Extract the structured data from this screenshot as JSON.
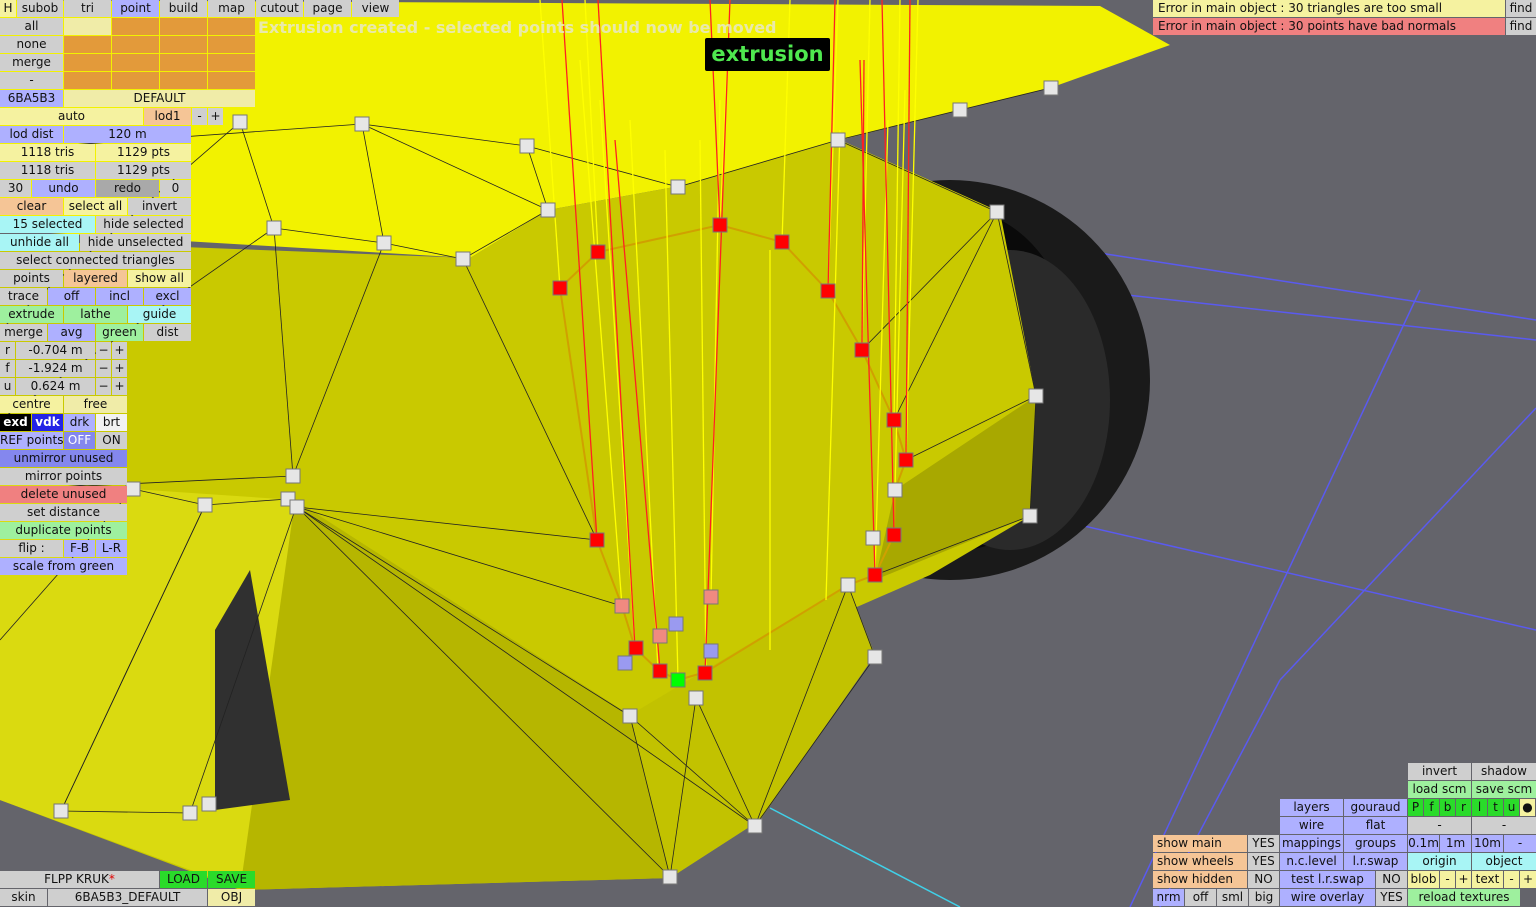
{
  "top_tabs": {
    "h": "H",
    "subob": "subob",
    "tri": "tri",
    "point": "point",
    "build": "build",
    "map": "map",
    "cutout": "cutout",
    "page": "page",
    "view": "view"
  },
  "status_message": "Extrusion created - selected points should now be moved",
  "mode_badge": "extrusion",
  "errors": [
    {
      "text": "Error in main object : 30 triangles are too small",
      "action": "find"
    },
    {
      "text": "Error in main object : 30 points have bad normals",
      "action": "find"
    }
  ],
  "left": {
    "all": "all",
    "none": "none",
    "merge": "merge",
    "dash": "-",
    "object_id": "6BA5B3",
    "skin_name": "DEFAULT",
    "auto": "auto",
    "lod": "lod1",
    "minus": "-",
    "plus": "+",
    "lod_dist_label": "lod dist",
    "lod_dist_value": "120 m",
    "tris1": "1118 tris",
    "pts1": "1129 pts",
    "tris2": "1118 tris",
    "pts2": "1129 pts",
    "undo_count": "30",
    "undo": "undo",
    "redo": "redo",
    "redo_count": "0",
    "clear": "clear",
    "select_all": "select all",
    "invert": "invert",
    "selected": "15 selected",
    "hide_selected": "hide selected",
    "unhide_all": "unhide all",
    "hide_unselected": "hide unselected",
    "select_connected": "select connected triangles",
    "points": "points",
    "layered": "layered",
    "show_all": "show all",
    "trace": "trace",
    "off": "off",
    "incl": "incl",
    "excl": "excl",
    "extrude": "extrude",
    "lathe": "lathe",
    "guide": "guide",
    "merge2": "merge",
    "avg": "avg",
    "green": "green",
    "dist": "dist",
    "r_label": "r",
    "r_value": "-0.704 m",
    "f_label": "f",
    "f_value": "-1.924 m",
    "u_label": "u",
    "u_value": "0.624 m",
    "centre": "centre",
    "free": "free",
    "exd": "exd",
    "vdk": "vdk",
    "drk": "drk",
    "brt": "brt",
    "ref_points": "REF points",
    "ref_off": "OFF",
    "ref_on": "ON",
    "unmirror": "unmirror unused",
    "mirror": "mirror points",
    "delete_unused": "delete unused",
    "set_distance": "set distance",
    "duplicate": "duplicate points",
    "flip": "flip :",
    "fb": "F-B",
    "lr": "L-R",
    "scale_green": "scale from green"
  },
  "bottom_left": {
    "car_name": "FLPP KRUK",
    "asterisk": "*",
    "load": "LOAD",
    "save": "SAVE",
    "skin": "skin",
    "skin_value": "6BA5B3_DEFAULT",
    "obj": "OBJ"
  },
  "bottom_right": {
    "invert": "invert",
    "shadow": "shadow",
    "load_scm": "load scm",
    "save_scm": "save scm",
    "layers": "layers",
    "gouraud": "gouraud",
    "flags": [
      "P",
      "f",
      "b",
      "r",
      "l",
      "t",
      "u",
      "●"
    ],
    "wire": "wire",
    "flat": "flat",
    "dash1": "-",
    "dash2": "-",
    "show_main": "show main",
    "show_main_v": "YES",
    "mappings": "mappings",
    "groups": "groups",
    "s01": "0.1m",
    "s1": "1m",
    "s10": "10m",
    "sdash": "-",
    "show_wheels": "show wheels",
    "show_wheels_v": "YES",
    "nclevel": "n.c.level",
    "lrswap": "l.r.swap",
    "origin": "origin",
    "object": "object",
    "show_hidden": "show hidden",
    "show_hidden_v": "NO",
    "test_lr": "test l.r.swap",
    "test_lr_v": "NO",
    "blob": "blob",
    "bminus": "-",
    "bplus": "+",
    "text": "text",
    "tminus": "-",
    "tplus": "+",
    "nrm": "nrm",
    "off": "off",
    "sml": "sml",
    "big": "big",
    "wire_overlay": "wire overlay",
    "wire_overlay_v": "YES",
    "reload": "reload textures"
  },
  "colors": {
    "viewport_bg": "#64646b",
    "mesh_yellow": "#ecec00",
    "selected_point": "#ff0000",
    "green_point": "#00ff00"
  }
}
